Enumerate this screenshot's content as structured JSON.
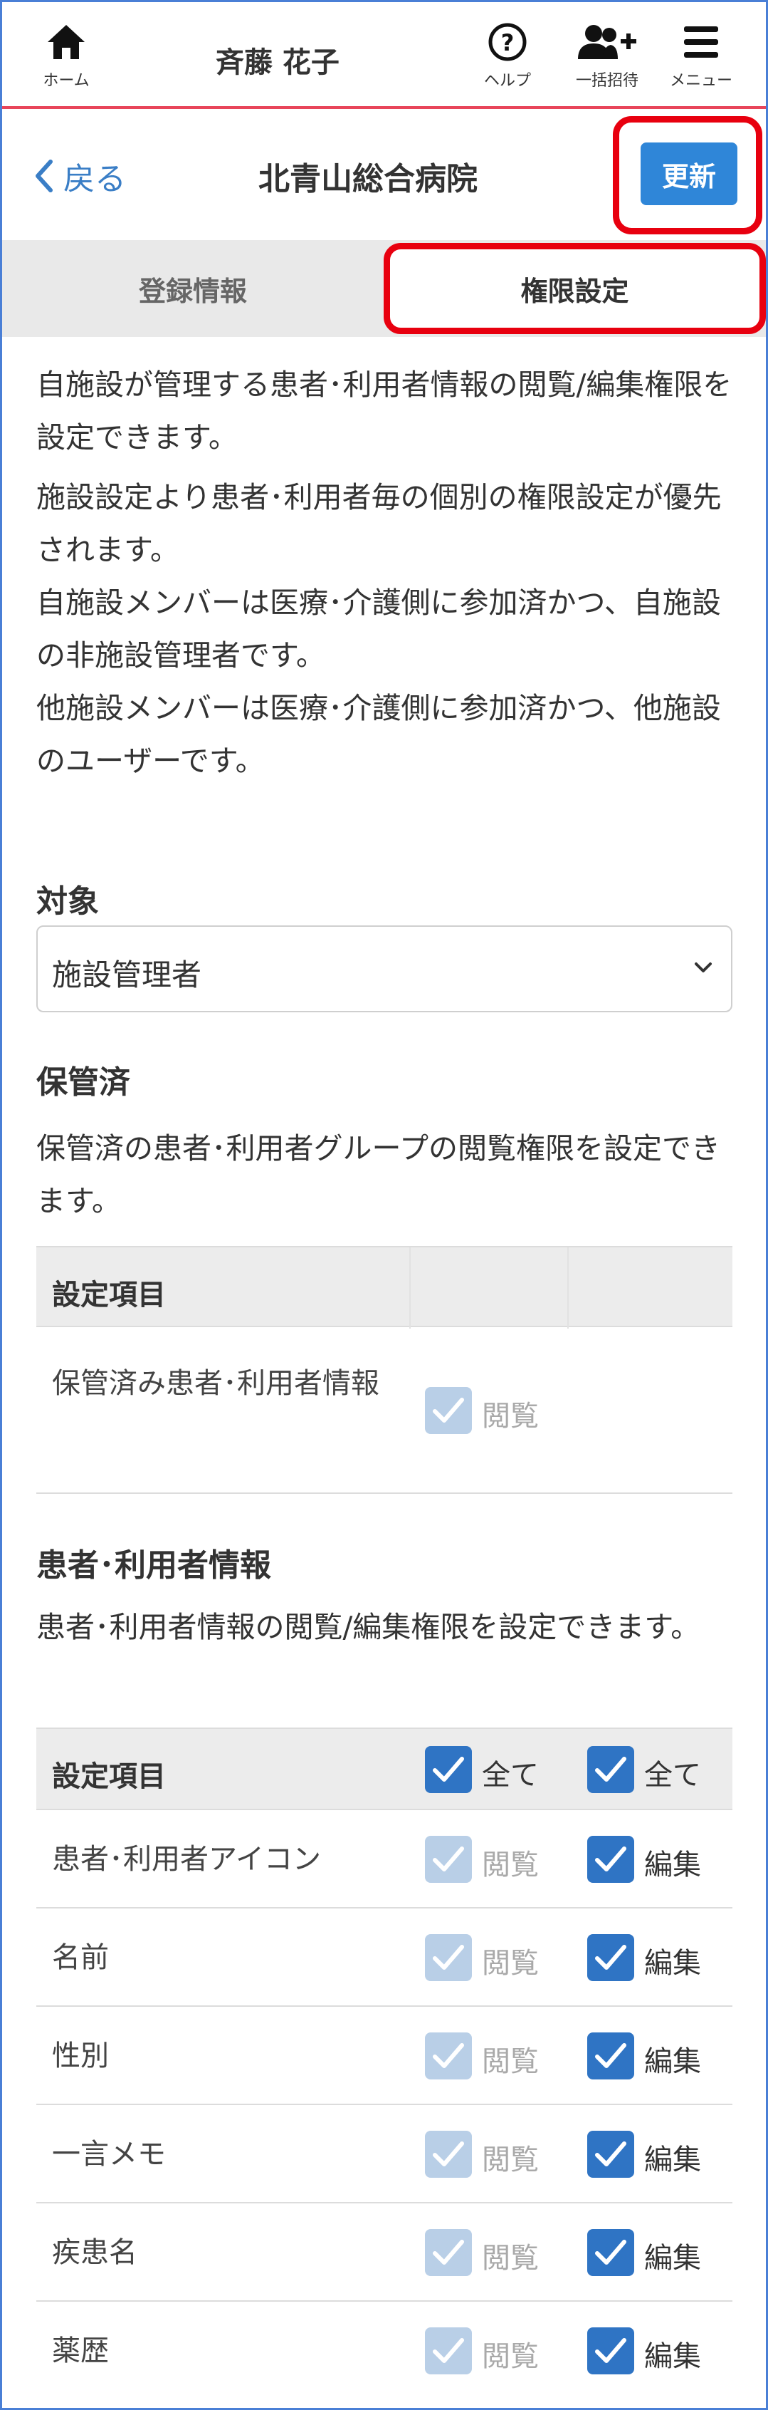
{
  "header": {
    "home_label": "ホーム",
    "user_name": "斉藤 花子",
    "help_label": "ヘルプ",
    "invite_label": "一括招待",
    "menu_label": "メニュー"
  },
  "subheader": {
    "back_label": "戻る",
    "facility_name": "北青山総合病院",
    "refresh_label": "更新"
  },
  "tabs": [
    {
      "label": "登録情報",
      "active": false
    },
    {
      "label": "権限設定",
      "active": true
    }
  ],
  "intro": {
    "p1": "自施設が管理する患者･利用者情報の閲覧/編集権限を設定できます。",
    "p2": "施設設定より患者･利用者毎の個別の権限設定が優先されます。",
    "p3": "自施設メンバーは医療･介護側に参加済かつ、自施設の非施設管理者です。",
    "p4": "他施設メンバーは医療･介護側に参加済かつ、他施設のユーザーです。"
  },
  "target": {
    "title": "対象",
    "selected": "施設管理者"
  },
  "archived": {
    "title": "保管済",
    "description": "保管済の患者･利用者グループの閲覧権限を設定できます。",
    "header_label": "設定項目",
    "rows": [
      {
        "label": "保管済み患者･利用者情報",
        "view_label": "閲覧",
        "view_checked": true
      }
    ]
  },
  "patient_info": {
    "title": "患者･利用者情報",
    "description": "患者･利用者情報の閲覧/編集権限を設定できます。",
    "header_label": "設定項目",
    "all_view_label": "全て",
    "all_edit_label": "全て",
    "rows": [
      {
        "label": "患者･利用者アイコン",
        "view_label": "閲覧",
        "edit_label": "編集"
      },
      {
        "label": "名前",
        "view_label": "閲覧",
        "edit_label": "編集"
      },
      {
        "label": "性別",
        "view_label": "閲覧",
        "edit_label": "編集"
      },
      {
        "label": "一言メモ",
        "view_label": "閲覧",
        "edit_label": "編集"
      },
      {
        "label": "疾患名",
        "view_label": "閲覧",
        "edit_label": "編集"
      },
      {
        "label": "薬歴",
        "view_label": "閲覧",
        "edit_label": "編集"
      }
    ]
  },
  "colors": {
    "accent": "#2f86d8",
    "header_line": "#e8455a",
    "highlight": "#e8000f",
    "checkbox_on": "#2f74c4",
    "checkbox_disabled": "#b9cfe7"
  }
}
